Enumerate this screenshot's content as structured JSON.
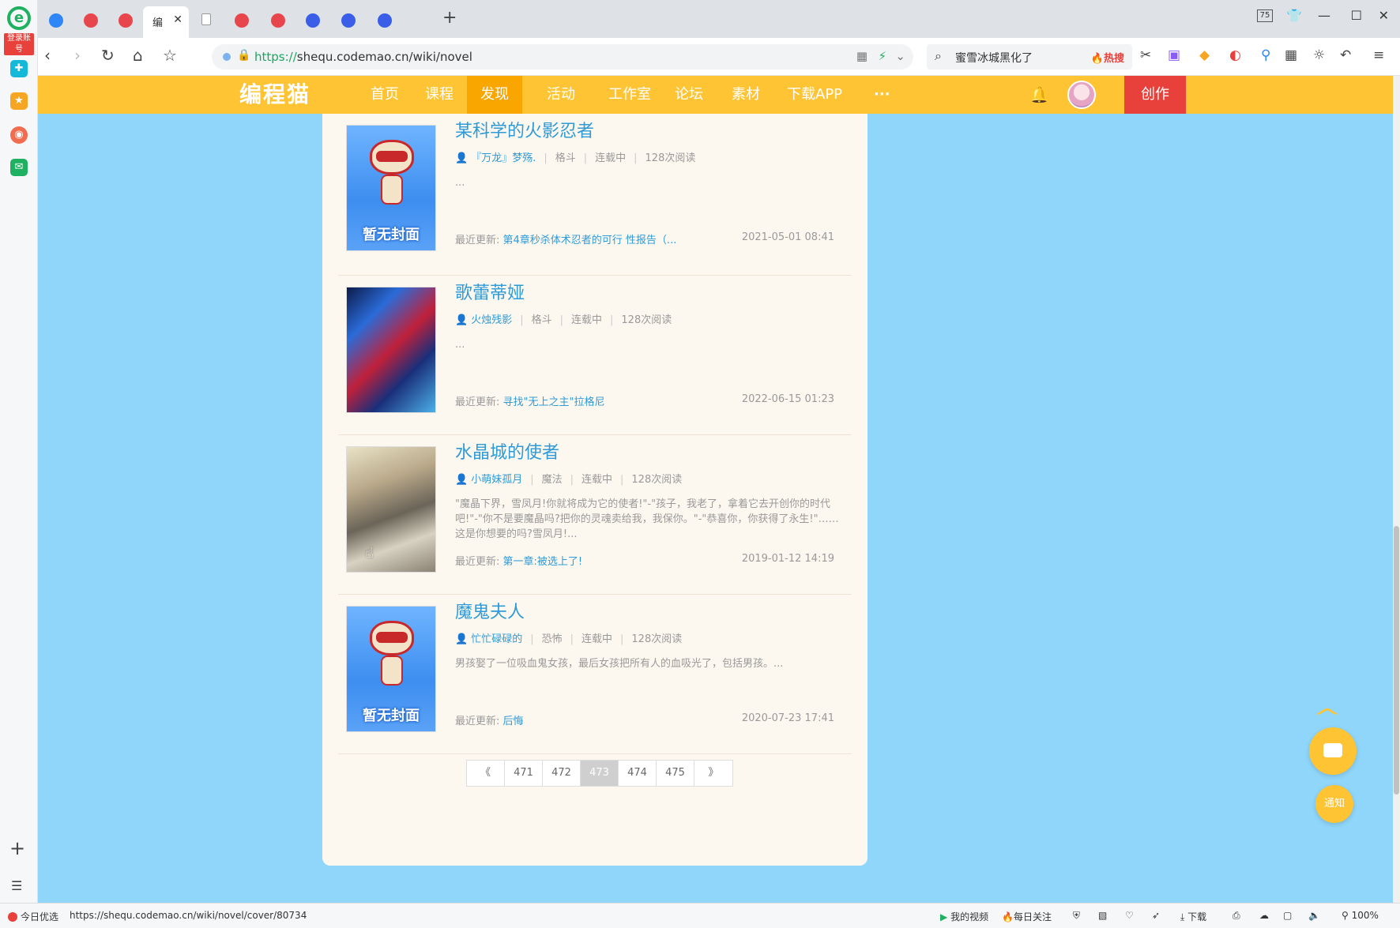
{
  "browser": {
    "sidebar": {
      "login_label": "登录账号"
    },
    "tabs": [
      {
        "label": ""
      },
      {
        "label": ""
      },
      {
        "label": ""
      },
      {
        "label": "编"
      },
      {
        "label": ""
      },
      {
        "label": ""
      },
      {
        "label": ""
      },
      {
        "label": ""
      },
      {
        "label": ""
      },
      {
        "label": ""
      }
    ],
    "active_tab_title": "编",
    "zoom_badge": "75",
    "url_scheme": "https://",
    "url_rest": "shequ.codemao.cn/wiki/novel",
    "search_query": "蜜雪冰城黑化了",
    "search_hot": "🔥热搜",
    "status_left": "今日优选",
    "status_url": "https://shequ.codemao.cn/wiki/novel/cover/80734",
    "status_video": "我的视频",
    "status_follow": "每日关注",
    "status_download": "下载",
    "zoom": "100%"
  },
  "site": {
    "logo": "编程猫",
    "nav": [
      "首页",
      "课程",
      "发现",
      "活动",
      "工作室",
      "论坛",
      "素材",
      "下载APP",
      "···"
    ],
    "active_nav": "发现",
    "create_label": "创作",
    "notify_label": "通知"
  },
  "novels": [
    {
      "title": "某科学的火影忍者",
      "author": "『万龙』梦殇.",
      "genre": "格斗",
      "status": "连载中",
      "reads": "128次阅读",
      "desc": "...",
      "update_label": "最近更新:",
      "chapter": "第4章秒杀体术忍者的可行 性报告（...",
      "date": "2021-05-01 08:41",
      "cover": "no-cover",
      "cover_label": "暂无封面"
    },
    {
      "title": "歌蕾蒂娅",
      "author": "火烛残影",
      "genre": "格斗",
      "status": "连载中",
      "reads": "128次阅读",
      "desc": "...",
      "update_label": "最近更新:",
      "chapter": "寻找\"无上之主\"拉格尼",
      "date": "2022-06-15 01:23",
      "cover": "art",
      "cover_label": ""
    },
    {
      "title": "水晶城的使者",
      "author": "小萌妹孤月",
      "genre": "魔法",
      "status": "连载中",
      "reads": "128次阅读",
      "desc": "\"魔晶下界，雪凤月!你就将成为它的使者!\"-\"孩子，我老了，拿着它去开创你的时代吧!\"-\"你不是要魔晶吗?把你的灵魂卖给我，我保你。\"-\"恭喜你，你获得了永生!\"……这是你想要的吗?雪凤月!...",
      "update_label": "最近更新:",
      "chapter": "第一章:被选上了!",
      "date": "2019-01-12 14:19",
      "cover": "art",
      "cover_label": ""
    },
    {
      "title": "魔鬼夫人",
      "author": "忙忙碌碌的",
      "genre": "恐怖",
      "status": "连载中",
      "reads": "128次阅读",
      "desc": "男孩娶了一位吸血鬼女孩，最后女孩把所有人的血吸光了，包括男孩。...",
      "update_label": "最近更新:",
      "chapter": "后悔",
      "date": "2020-07-23 17:41",
      "cover": "no-cover",
      "cover_label": "暂无封面"
    }
  ],
  "pagination": {
    "prev": "《",
    "pages": [
      "471",
      "472",
      "473",
      "474",
      "475"
    ],
    "current": "473",
    "next": "》"
  },
  "colors": {
    "header_yellow": "#fec433",
    "active_nav": "#f9a600",
    "create_red": "#e8403a",
    "page_bg": "#8fd6fa",
    "link_blue": "#2e9ad6"
  }
}
